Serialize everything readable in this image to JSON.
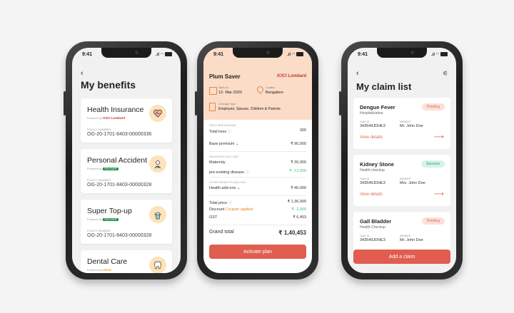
{
  "time": "9:41",
  "phone1": {
    "back": "‹",
    "title": "My benefits",
    "powered_by": "Powered by",
    "cards": [
      {
        "name": "Health Insurance",
        "insurer": "ICICI Lombard",
        "policy_label": "POLICY NUMBER",
        "policy_number": "OG-20-1701-8403-00000336",
        "icon": "heart-icon"
      },
      {
        "name": "Personal Accident",
        "insurer": "RELIGARE",
        "policy_label": "POLICY NUMBER",
        "policy_number": "OG-20-1701-8403-00000328",
        "icon": "accident-icon"
      },
      {
        "name": "Super Top-up",
        "insurer": "RELIGARE",
        "policy_label": "POLICY NUMBER",
        "policy_number": "OG-20-1701-8403-00000328",
        "icon": "cupcake-icon"
      },
      {
        "name": "Dental Care",
        "insurer": "clove",
        "icon": "tooth-icon"
      }
    ]
  },
  "phone2": {
    "header": "Plum Saver",
    "insurer": "ICICI Lombard",
    "starts_on_label": "Starts on",
    "starts_on": "12- Mar-2020",
    "location_label": "Location",
    "location": "Bangalore",
    "coverage_label": "Coverage Type",
    "coverage": "Employee, Spouse, Children & Parents",
    "price_breakdown_label": "PRICE BREAKDOWN",
    "total_lives_label": "Total lives",
    "total_lives": "300",
    "base_premium_label": "Base premium",
    "base_premium": "₹ 90,000",
    "insurance_addons_label": "INSURANCE ADD-ONS",
    "maternity_label": "Maternity",
    "maternity": "₹ 30,000",
    "preexisting_label": "pre-existing disease",
    "preexisting": "₹ -12,000",
    "other_addons_label": "OTHER BENEFITS ADD-ONS",
    "health_addons_label": "Health add-ons",
    "health_addons": "₹ 40,000",
    "total_price_label": "Total price",
    "total_price": "₹ 1,36,000",
    "discount_label": "Discount",
    "coupon": "Coupon applied",
    "discount": "₹ -2,000",
    "gst_label": "GST",
    "gst": "₹ 6,453",
    "grand_total_label": "Grand total",
    "grand_total": "₹ 1,40,453",
    "cta": "Activate plan"
  },
  "phone3": {
    "back": "‹",
    "title": "My claim list",
    "claim_id_label": "Claim ID",
    "member_label": "MEMBER",
    "view_details": "View details",
    "claims": [
      {
        "name": "Dengue Fever",
        "type": "Hospitalization",
        "status": "Pending",
        "claim_id": "343549JDHE3",
        "member": "Mr. John Doe"
      },
      {
        "name": "Kidney Stone",
        "type": "Health-checkup",
        "status": "Success",
        "claim_id": "343549JDHE3",
        "member": "Mrs. John Doe"
      },
      {
        "name": "Gall Bladder",
        "type": "Health-Checkup",
        "status": "Pending",
        "claim_id": "343549JDHE3",
        "member": "Mr. John Doe"
      }
    ],
    "cta": "Add a claim"
  },
  "colors": {
    "accent": "#e05d4f",
    "peach": "#fbdcc7",
    "pending_bg": "#fde0d8",
    "success_bg": "#d6f3e6"
  }
}
